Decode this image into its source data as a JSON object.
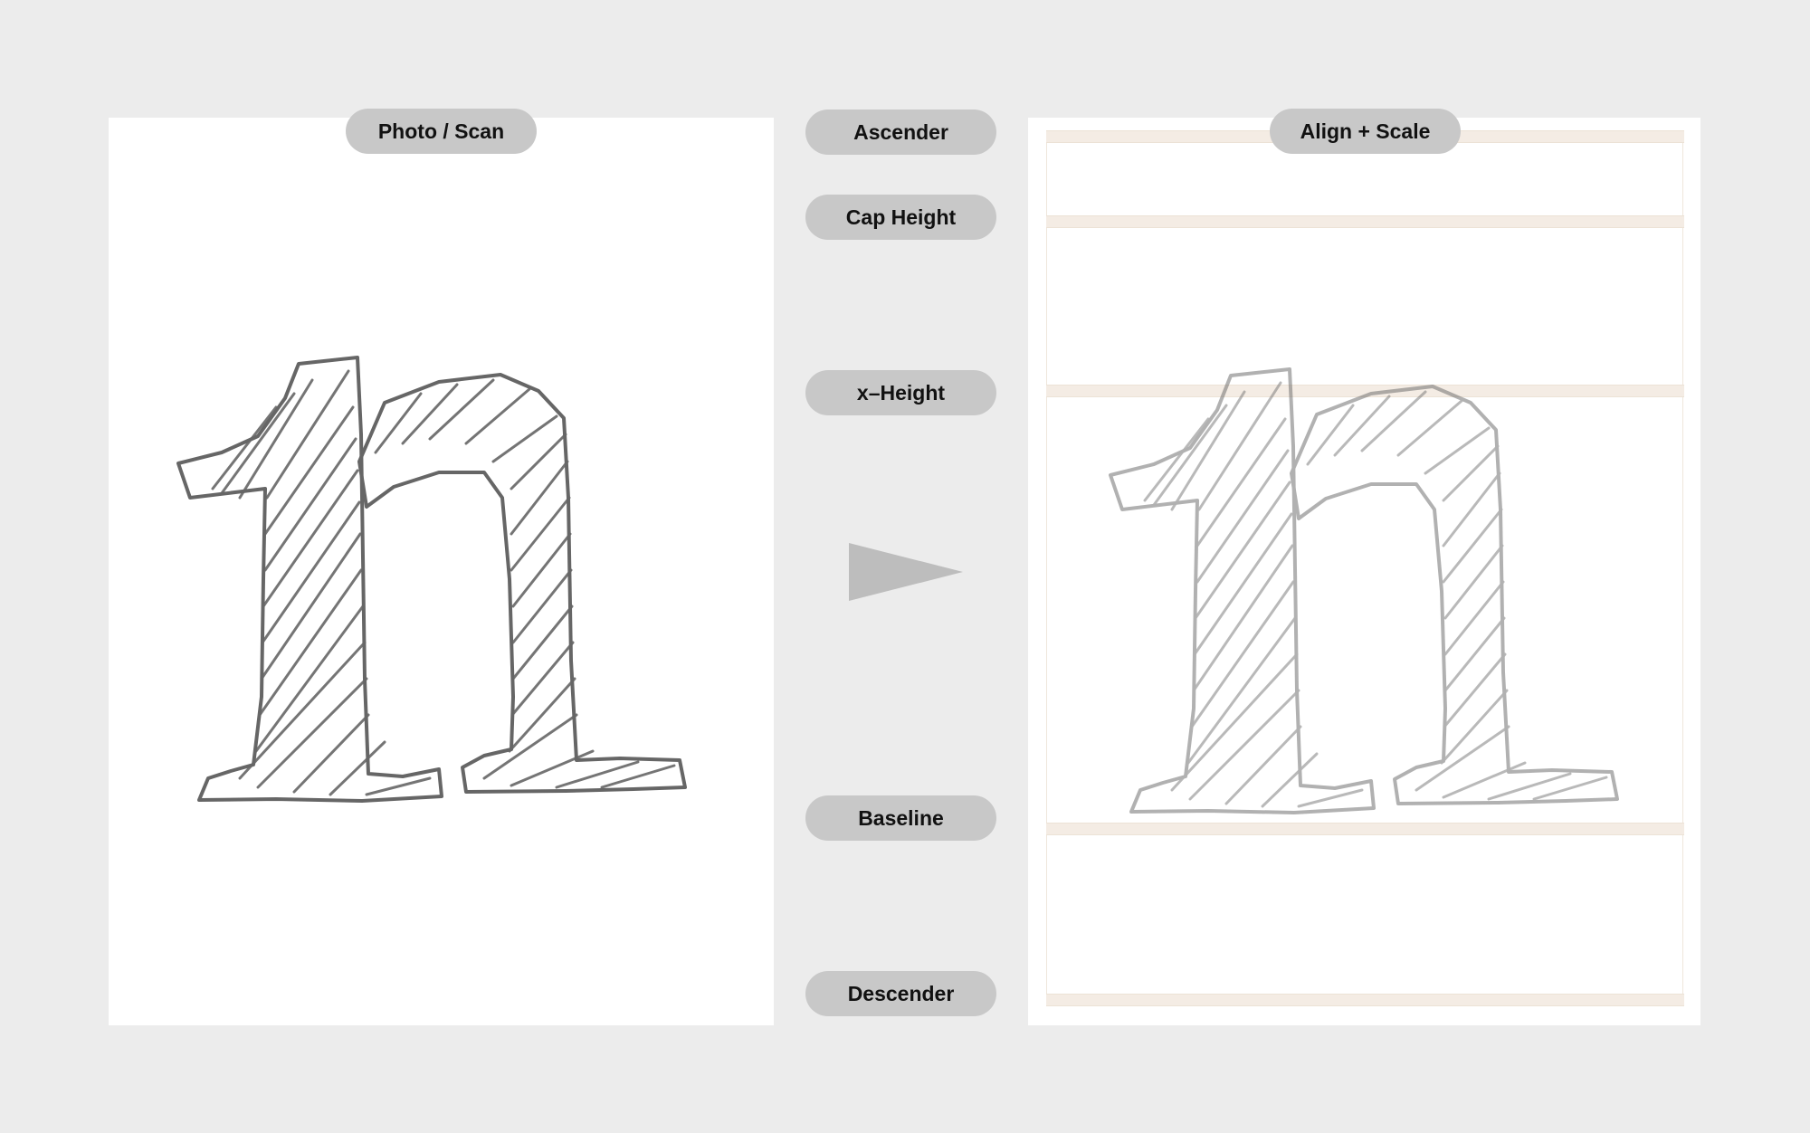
{
  "panels": {
    "source_label": "Photo / Scan",
    "result_label": "Align + Scale"
  },
  "metrics": {
    "ascender": "Ascender",
    "cap_height": "Cap Height",
    "x_height": "x–Height",
    "baseline": "Baseline",
    "descender": "Descender"
  },
  "icons": {
    "process_arrow": "play-triangle-icon"
  },
  "colors": {
    "background": "#ececec",
    "panel": "#ffffff",
    "pill": "#c8c8c8",
    "glyph_stroke": "#666666",
    "guide_band": "#f4ece4"
  }
}
